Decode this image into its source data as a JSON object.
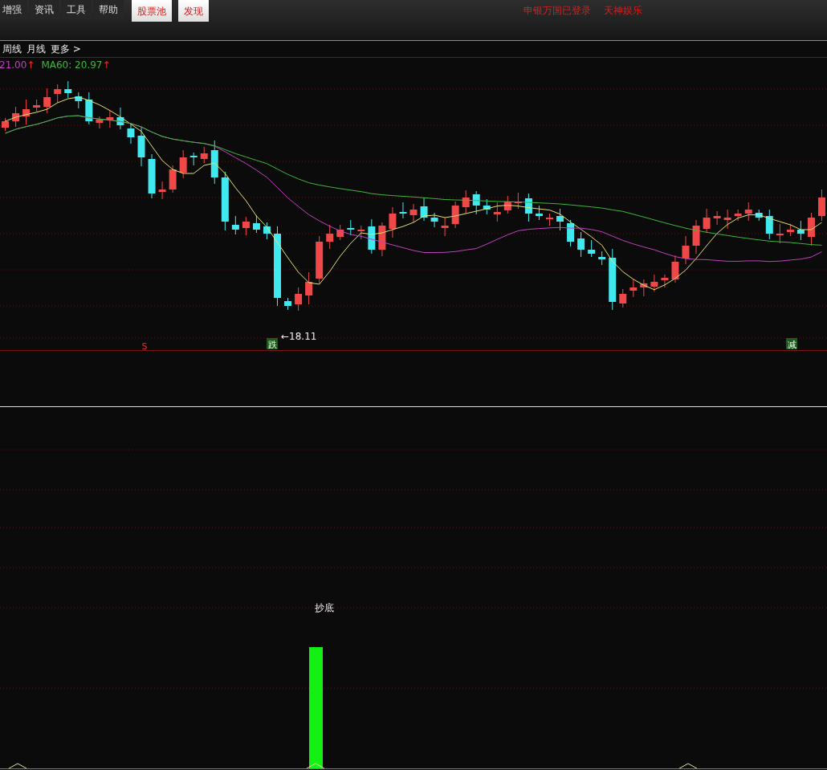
{
  "menu": [
    {
      "label": "增强",
      "highlighted": false
    },
    {
      "label": "资讯",
      "highlighted": false
    },
    {
      "label": "工具",
      "highlighted": false
    },
    {
      "label": "帮助",
      "highlighted": false
    },
    {
      "label": "股票池",
      "highlighted": true
    },
    {
      "label": "发现",
      "highlighted": true
    }
  ],
  "status_texts": [
    "申银万国已登录",
    "天神娱乐"
  ],
  "period_tabs": [
    "周线",
    "月线",
    "更多 >"
  ],
  "legend": [
    {
      "text": "21.00",
      "color": "#c040c0",
      "arrow": "↑"
    },
    {
      "text": "MA60: 20.97",
      "color": "#3cb83c",
      "arrow": "↑"
    }
  ],
  "main_chart": {
    "low_label": "←18.11",
    "signals": [
      {
        "text": "S",
        "kind": "text"
      },
      {
        "text": "跌",
        "kind": "box"
      },
      {
        "text": "减",
        "kind": "box"
      }
    ]
  },
  "indicator_panel": {
    "signal_label": "抄底"
  }
}
